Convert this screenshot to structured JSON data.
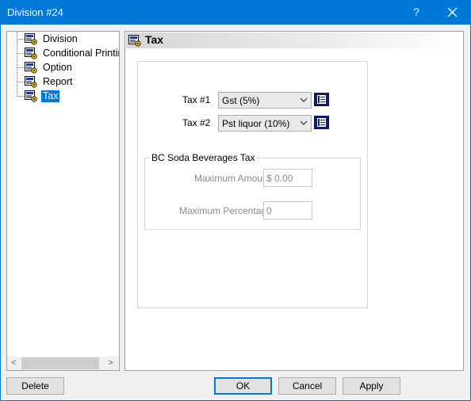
{
  "window": {
    "title": "Division #24",
    "help_label": "?"
  },
  "tree": {
    "items": [
      {
        "label": "Division",
        "selected": false
      },
      {
        "label": "Conditional Printing",
        "selected": false
      },
      {
        "label": "Option",
        "selected": false
      },
      {
        "label": "Report",
        "selected": false
      },
      {
        "label": "Tax",
        "selected": true
      }
    ],
    "scroll_left": "<",
    "scroll_right": ">"
  },
  "panel": {
    "title": "Tax",
    "tax1": {
      "label": "Tax #1",
      "value": "Gst (5%)"
    },
    "tax2": {
      "label": "Tax #2",
      "value": "Pst liquor (10%)"
    },
    "group": {
      "title": "BC Soda Beverages Tax",
      "max_amount_label": "Maximum Amount",
      "max_amount_value": "$ 0.00",
      "max_percentage_label": "Maximum Percentage",
      "max_percentage_value": "0"
    }
  },
  "buttons": {
    "delete": "Delete",
    "ok": "OK",
    "cancel": "Cancel",
    "apply": "Apply"
  },
  "colors": {
    "titlebar": "#0078d7",
    "selection": "#0078d7",
    "lookup_button": "#0f1e6e"
  }
}
